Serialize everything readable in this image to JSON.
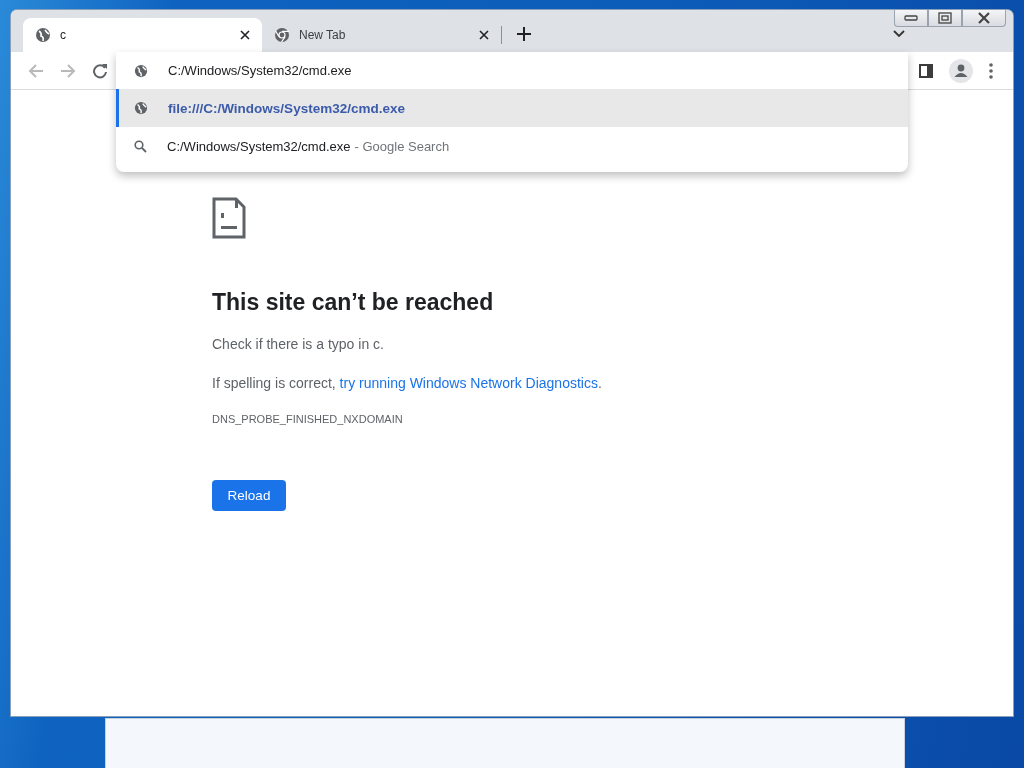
{
  "tabs": [
    {
      "title": "c",
      "kind": "page",
      "selected": true
    },
    {
      "title": "New Tab",
      "kind": "newtab",
      "selected": false
    }
  ],
  "omnibox": {
    "value": "C:/Windows/System32/cmd.exe"
  },
  "suggestions": [
    {
      "kind": "url",
      "text": "file:///C:/Windows/System32/cmd.exe",
      "selected": true
    },
    {
      "kind": "search",
      "text": "C:/Windows/System32/cmd.exe",
      "suffix": "- Google Search",
      "selected": false
    }
  ],
  "error_page": {
    "heading": "This site can’t be reached",
    "hint": "Check if there is a typo in c.",
    "advice": "If spelling is correct,",
    "advice_link": "try running Windows Network Diagnostics",
    "advice_end": ".",
    "code": "DNS_PROBE_FINISHED_NXDOMAIN",
    "button": "Reload"
  }
}
